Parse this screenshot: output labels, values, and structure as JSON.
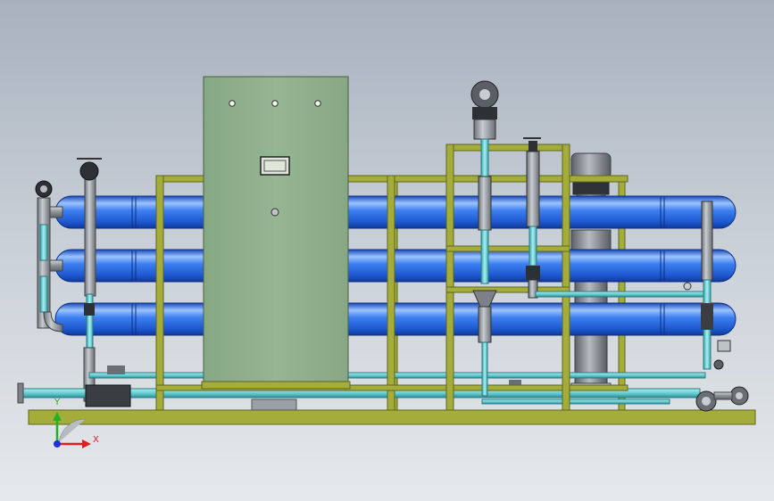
{
  "colors": {
    "background_top": "#a8b1bd",
    "background_bottom": "#e6e9ec",
    "frame": "#a5ad3a",
    "frame_edge": "#5e6420",
    "vessel_blue": "#2f6fe0",
    "vessel_highlight": "#9cc3ff",
    "cabinet": "#8fb08b",
    "pipe_cyan": "#6fd3d8",
    "pipe_gray": "#8a8f95",
    "pump_gray": "#8e939a",
    "axis_x": "#e02020",
    "axis_y": "#20b020",
    "axis_z": "#2030e0"
  },
  "components": {
    "pressure_vessels": 3,
    "cabinet_indicator_lights": 3
  },
  "triad": {
    "x_label": "X",
    "y_label": "Y"
  }
}
